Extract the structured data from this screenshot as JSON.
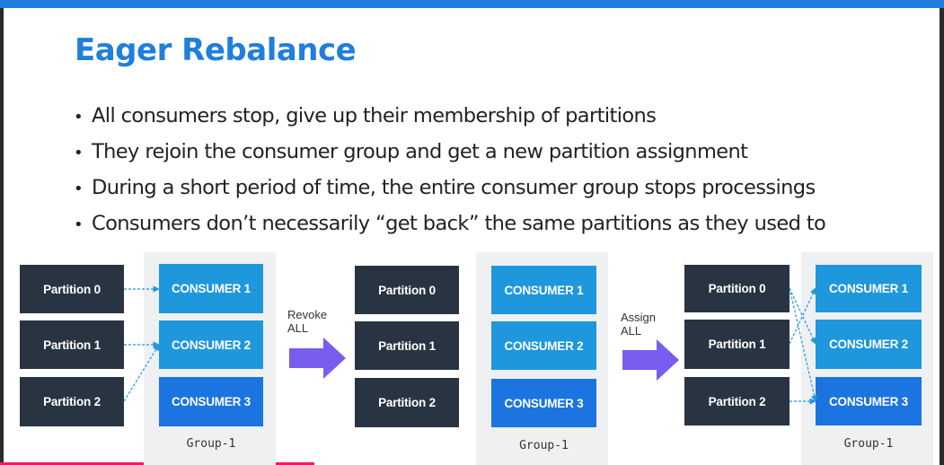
{
  "title": "Eager Rebalance",
  "bullets": [
    "All consumers stop, give up their membership of partitions",
    "They rejoin the consumer group and get a new partition assignment",
    "During a short period of time, the entire consumer group stops processings",
    "Consumers don’t necessarily “get back” the same partitions as they used to"
  ],
  "partitions": [
    "Partition 0",
    "Partition 1",
    "Partition 2"
  ],
  "consumers": [
    "CONSUMER 1",
    "CONSUMER 2",
    "CONSUMER 3"
  ],
  "group_label": "Group-1",
  "steps": {
    "revoke": [
      "Revoke",
      "ALL"
    ],
    "assign": [
      "Assign",
      "ALL"
    ]
  },
  "colors": {
    "title": "#1f7fdc",
    "partition_box": "#293442",
    "consumer_box": "#1f97dc",
    "consumer_box_3": "#1c74e0",
    "arrow": "#7b5cf0",
    "connector": "#1f97dc"
  },
  "connections": {
    "before": [
      [
        0,
        0
      ],
      [
        1,
        1
      ],
      [
        2,
        1
      ]
    ],
    "after": [
      [
        0,
        1
      ],
      [
        0,
        2
      ],
      [
        1,
        0
      ],
      [
        2,
        2
      ]
    ]
  }
}
